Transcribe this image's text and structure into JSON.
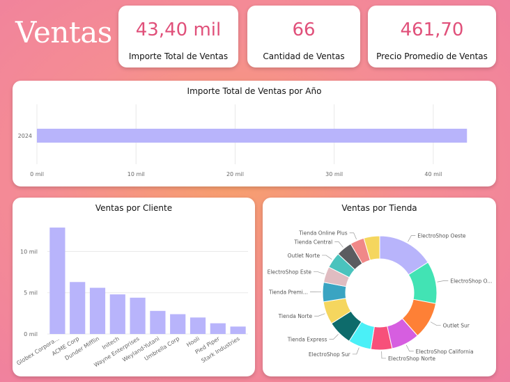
{
  "page": {
    "title": "Ventas"
  },
  "kpis": [
    {
      "value": "43,40 mil",
      "label": "Importe Total de Ventas"
    },
    {
      "value": "66",
      "label": "Cantidad de Ventas"
    },
    {
      "value": "461,70",
      "label": "Precio Promedio de Ventas"
    }
  ],
  "colors": {
    "accent": "#e0507a",
    "bar": "#b8b4fb"
  },
  "chart_data": [
    {
      "type": "bar",
      "orientation": "horizontal",
      "title": "Importe Total de Ventas por Año",
      "categories": [
        "2024"
      ],
      "values": [
        43400
      ],
      "xlim": [
        0,
        45000
      ],
      "xticks": [
        0,
        10000,
        20000,
        30000,
        40000
      ],
      "xtick_labels": [
        "0 mil",
        "10 mil",
        "20 mil",
        "30 mil",
        "40 mil"
      ]
    },
    {
      "type": "bar",
      "title": "Ventas por Cliente",
      "categories": [
        "Globex Corpora...",
        "ACME Corp",
        "Dunder Mifflin",
        "Initech",
        "Wayne Enterprises",
        "Weyland-Yutani",
        "Umbrella Corp",
        "Hooli",
        "Pied Piper",
        "Stark Industries"
      ],
      "values": [
        12900,
        6300,
        5600,
        4800,
        4400,
        2800,
        2400,
        2000,
        1300,
        900
      ],
      "ylim": [
        0,
        14000
      ],
      "yticks": [
        0,
        5000,
        10000
      ],
      "ytick_labels": [
        "0 mil",
        "5 mil",
        "10 mil"
      ]
    },
    {
      "type": "pie",
      "donut": true,
      "title": "Ventas por Tienda",
      "slices": [
        {
          "label": "ElectroShop Oeste",
          "value": 16.0,
          "color": "#b8b4fb"
        },
        {
          "label": "ElectroShop O...",
          "value": 12.0,
          "color": "#42e3b4"
        },
        {
          "label": "Outlet Sur",
          "value": 10.5,
          "color": "#fe8036"
        },
        {
          "label": "ElectroShop California",
          "value": 8.0,
          "color": "#d65ee0"
        },
        {
          "label": "ElectroShop Norte",
          "value": 6.0,
          "color": "#f7507a"
        },
        {
          "label": "ElectroShop Sur",
          "value": 6.5,
          "color": "#4af0f7"
        },
        {
          "label": "Tienda Express",
          "value": 7.0,
          "color": "#0d6b6b"
        },
        {
          "label": "Tienda Norte",
          "value": 6.5,
          "color": "#f5d65e"
        },
        {
          "label": "Tienda Premi...",
          "value": 5.5,
          "color": "#3aa4c2"
        },
        {
          "label": "ElectroShop Este",
          "value": 4.5,
          "color": "#e0bcc1"
        },
        {
          "label": "Outlet Norte",
          "value": 4.5,
          "color": "#4ac3bd"
        },
        {
          "label": "Tienda Central",
          "value": 4.5,
          "color": "#5b5c60"
        },
        {
          "label": "Tienda Online Plus",
          "value": 4.0,
          "color": "#f08888"
        },
        {
          "label": "",
          "value": 4.5,
          "color": "#f5d65e"
        }
      ]
    }
  ]
}
